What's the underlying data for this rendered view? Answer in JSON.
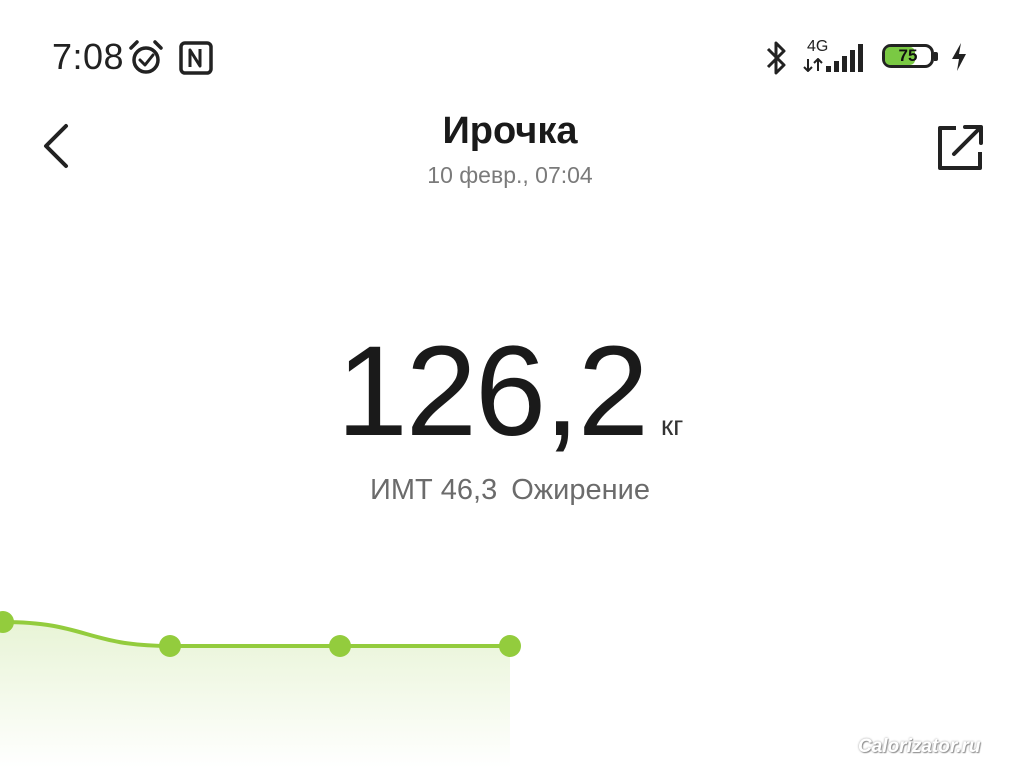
{
  "status_bar": {
    "time": "7:08",
    "network_type": "4G",
    "battery_level": "75",
    "battery_fraction": 0.75,
    "icons": [
      "alarm-icon",
      "nfc-icon",
      "bluetooth-icon",
      "data-arrows-icon",
      "signal-icon",
      "battery-icon",
      "charging-icon"
    ]
  },
  "header": {
    "title": "Ирочка",
    "subtitle": "10 февр., 07:04",
    "back_icon": "chevron-left-icon",
    "share_icon": "share-icon"
  },
  "measurement": {
    "weight": "126,2",
    "unit": "кг",
    "bmi_label": "ИМТ 46,3",
    "bmi_status": "Ожирение"
  },
  "colors": {
    "accent": "#93cc3d",
    "fill_top": "#e8f4d6",
    "fill_bottom": "#ffffff"
  },
  "watermark": "Calorizator.ru",
  "chart_data": {
    "type": "area",
    "points": 4,
    "values": [
      126.4,
      126.2,
      126.2,
      126.2
    ]
  }
}
